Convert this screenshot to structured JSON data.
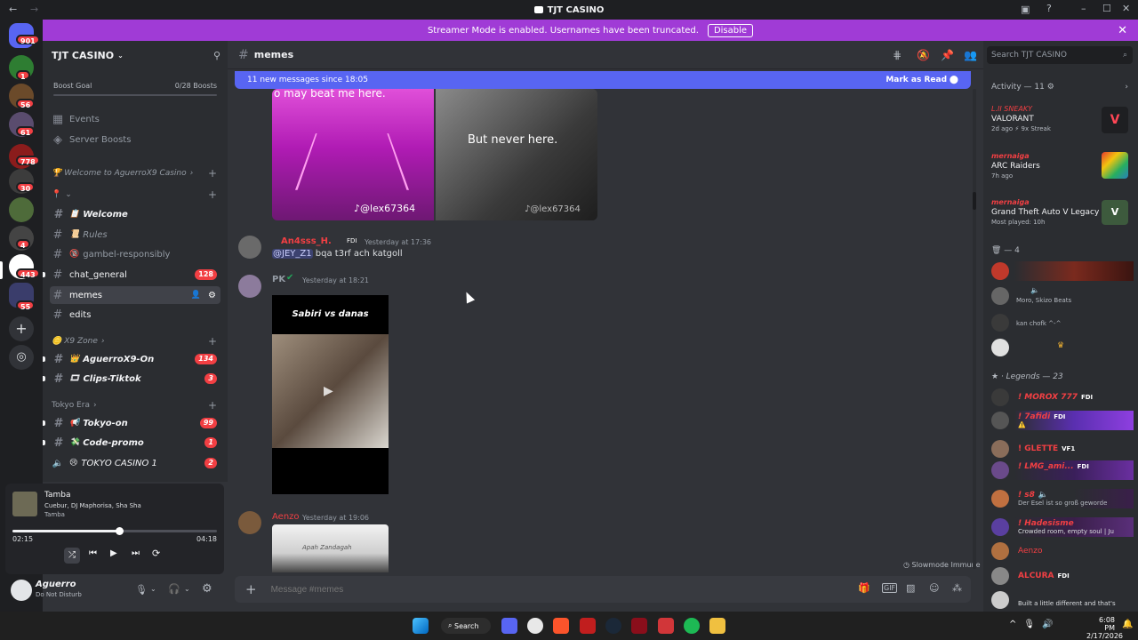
{
  "window": {
    "title": "TJT CASINO"
  },
  "banner": {
    "text": "Streamer Mode is enabled. Usernames have been truncated.",
    "disable": "Disable"
  },
  "rail": {
    "home_badge": "901",
    "badges": [
      "1",
      "56",
      "61",
      "778",
      "30",
      "4",
      "443",
      "55"
    ]
  },
  "server": {
    "name": "TJT CASINO",
    "boost_goal": "Boost Goal",
    "boost_count": "0/28 Boosts",
    "events": "Events",
    "server_boosts": "Server Boosts",
    "cat_welcome": "Welcome to AguerroX9 Casino",
    "channels_top": [
      {
        "label": "Welcome",
        "emoji": "📋"
      },
      {
        "label": "Rules",
        "emoji": "📜"
      },
      {
        "label": "gambel-responsibly",
        "emoji": "🔞"
      },
      {
        "label": "chat_general",
        "badge": "128"
      },
      {
        "label": "memes"
      },
      {
        "label": "edits"
      }
    ],
    "cat_x9": "X9 Zone",
    "channels_x9": [
      {
        "label": "AguerroX9-On",
        "badge": "134",
        "emoji": "👑"
      },
      {
        "label": "Clips-Tiktok",
        "badge": "3",
        "emoji": "🎞"
      }
    ],
    "cat_tokyo": "Tokyo Era",
    "channels_tokyo": [
      {
        "label": "Tokyo-on",
        "badge": "99",
        "emoji": "📢"
      },
      {
        "label": "Code-promo",
        "badge": "1",
        "emoji": "💸"
      },
      {
        "label": "TOKYO CASINO 1",
        "badge": "2",
        "emoji": "😢"
      }
    ]
  },
  "player": {
    "track": "Tamba",
    "artists": "Cuebur, DJ Maphorisa, Sha Sha",
    "album": "Tamba",
    "elapsed": "02:15",
    "duration": "04:18",
    "progress": 0.52
  },
  "user": {
    "name": "Aguerro",
    "status": "Do Not Disturb"
  },
  "chat": {
    "channel": "memes",
    "new_messages": "11 new messages since 18:05",
    "mark_read": "Mark as Read",
    "meme_caption_top": "o may beat me here.",
    "meme_caption_right": "But never here.",
    "meme_handle": "@lex67364",
    "messages": [
      {
        "user": "An4sss_H.",
        "tag": "FDI",
        "time": "Yesterday at 17:36",
        "mention": "@JEY_Z1",
        "text": "bqa t3rf ach katgoll"
      },
      {
        "user": "PK",
        "time": "Yesterday at 18:21",
        "video_title": "Sabiri vs danas"
      },
      {
        "user": "Aenzo",
        "time": "Yesterday at 19:06",
        "image_caption": "Apah Zandagah"
      }
    ],
    "slowmode": "Slowmode Immune",
    "composer_placeholder": "Message #memes"
  },
  "members": {
    "search_placeholder": "Search TJT CASINO",
    "activity_header": "Activity — 11",
    "activities": [
      {
        "user": "L.II SNEAKY",
        "game": "VALORANT",
        "meta": "2d ago  ⚡ 9x Streak"
      },
      {
        "user": "mernaiga",
        "game": "ARC Raiders",
        "meta": "7h ago"
      },
      {
        "user": "mernaiga",
        "game": "Grand Theft Auto V Legacy",
        "meta": "Most played: 10h"
      }
    ],
    "group_count": "4",
    "group_members": [
      {
        "name": "",
        "status": ""
      },
      {
        "name": "",
        "status": "Moro, Skizo Beats"
      },
      {
        "name": "",
        "status": "kan chofk ^-^"
      },
      {
        "name": "",
        "status": ""
      }
    ],
    "legends_header": "Legends — 23",
    "legends": [
      {
        "name": "! MOROX 777",
        "tag": "FDI",
        "status": ""
      },
      {
        "name": "! 7afidi",
        "tag": "FDI",
        "status": "⚠️"
      },
      {
        "name": "! GLETTE",
        "tag": "VF1",
        "status": ""
      },
      {
        "name": "! LMG_ami...",
        "tag": "FDI",
        "status": ""
      },
      {
        "name": "! s8",
        "tag": "",
        "status": "Der Esel ist so groß gewordе"
      },
      {
        "name": "! Hadesisme",
        "tag": "",
        "status": "Crowded room, empty soul | Ju"
      },
      {
        "name": "Aenzo",
        "tag": "",
        "status": ""
      },
      {
        "name": "ALCURA",
        "tag": "FDI",
        "status": ""
      },
      {
        "name": "",
        "tag": "",
        "status": "Built a little different and that's"
      }
    ]
  },
  "taskbar": {
    "search": "Search",
    "time": "6:08 PM",
    "date": "2/17/2026"
  }
}
